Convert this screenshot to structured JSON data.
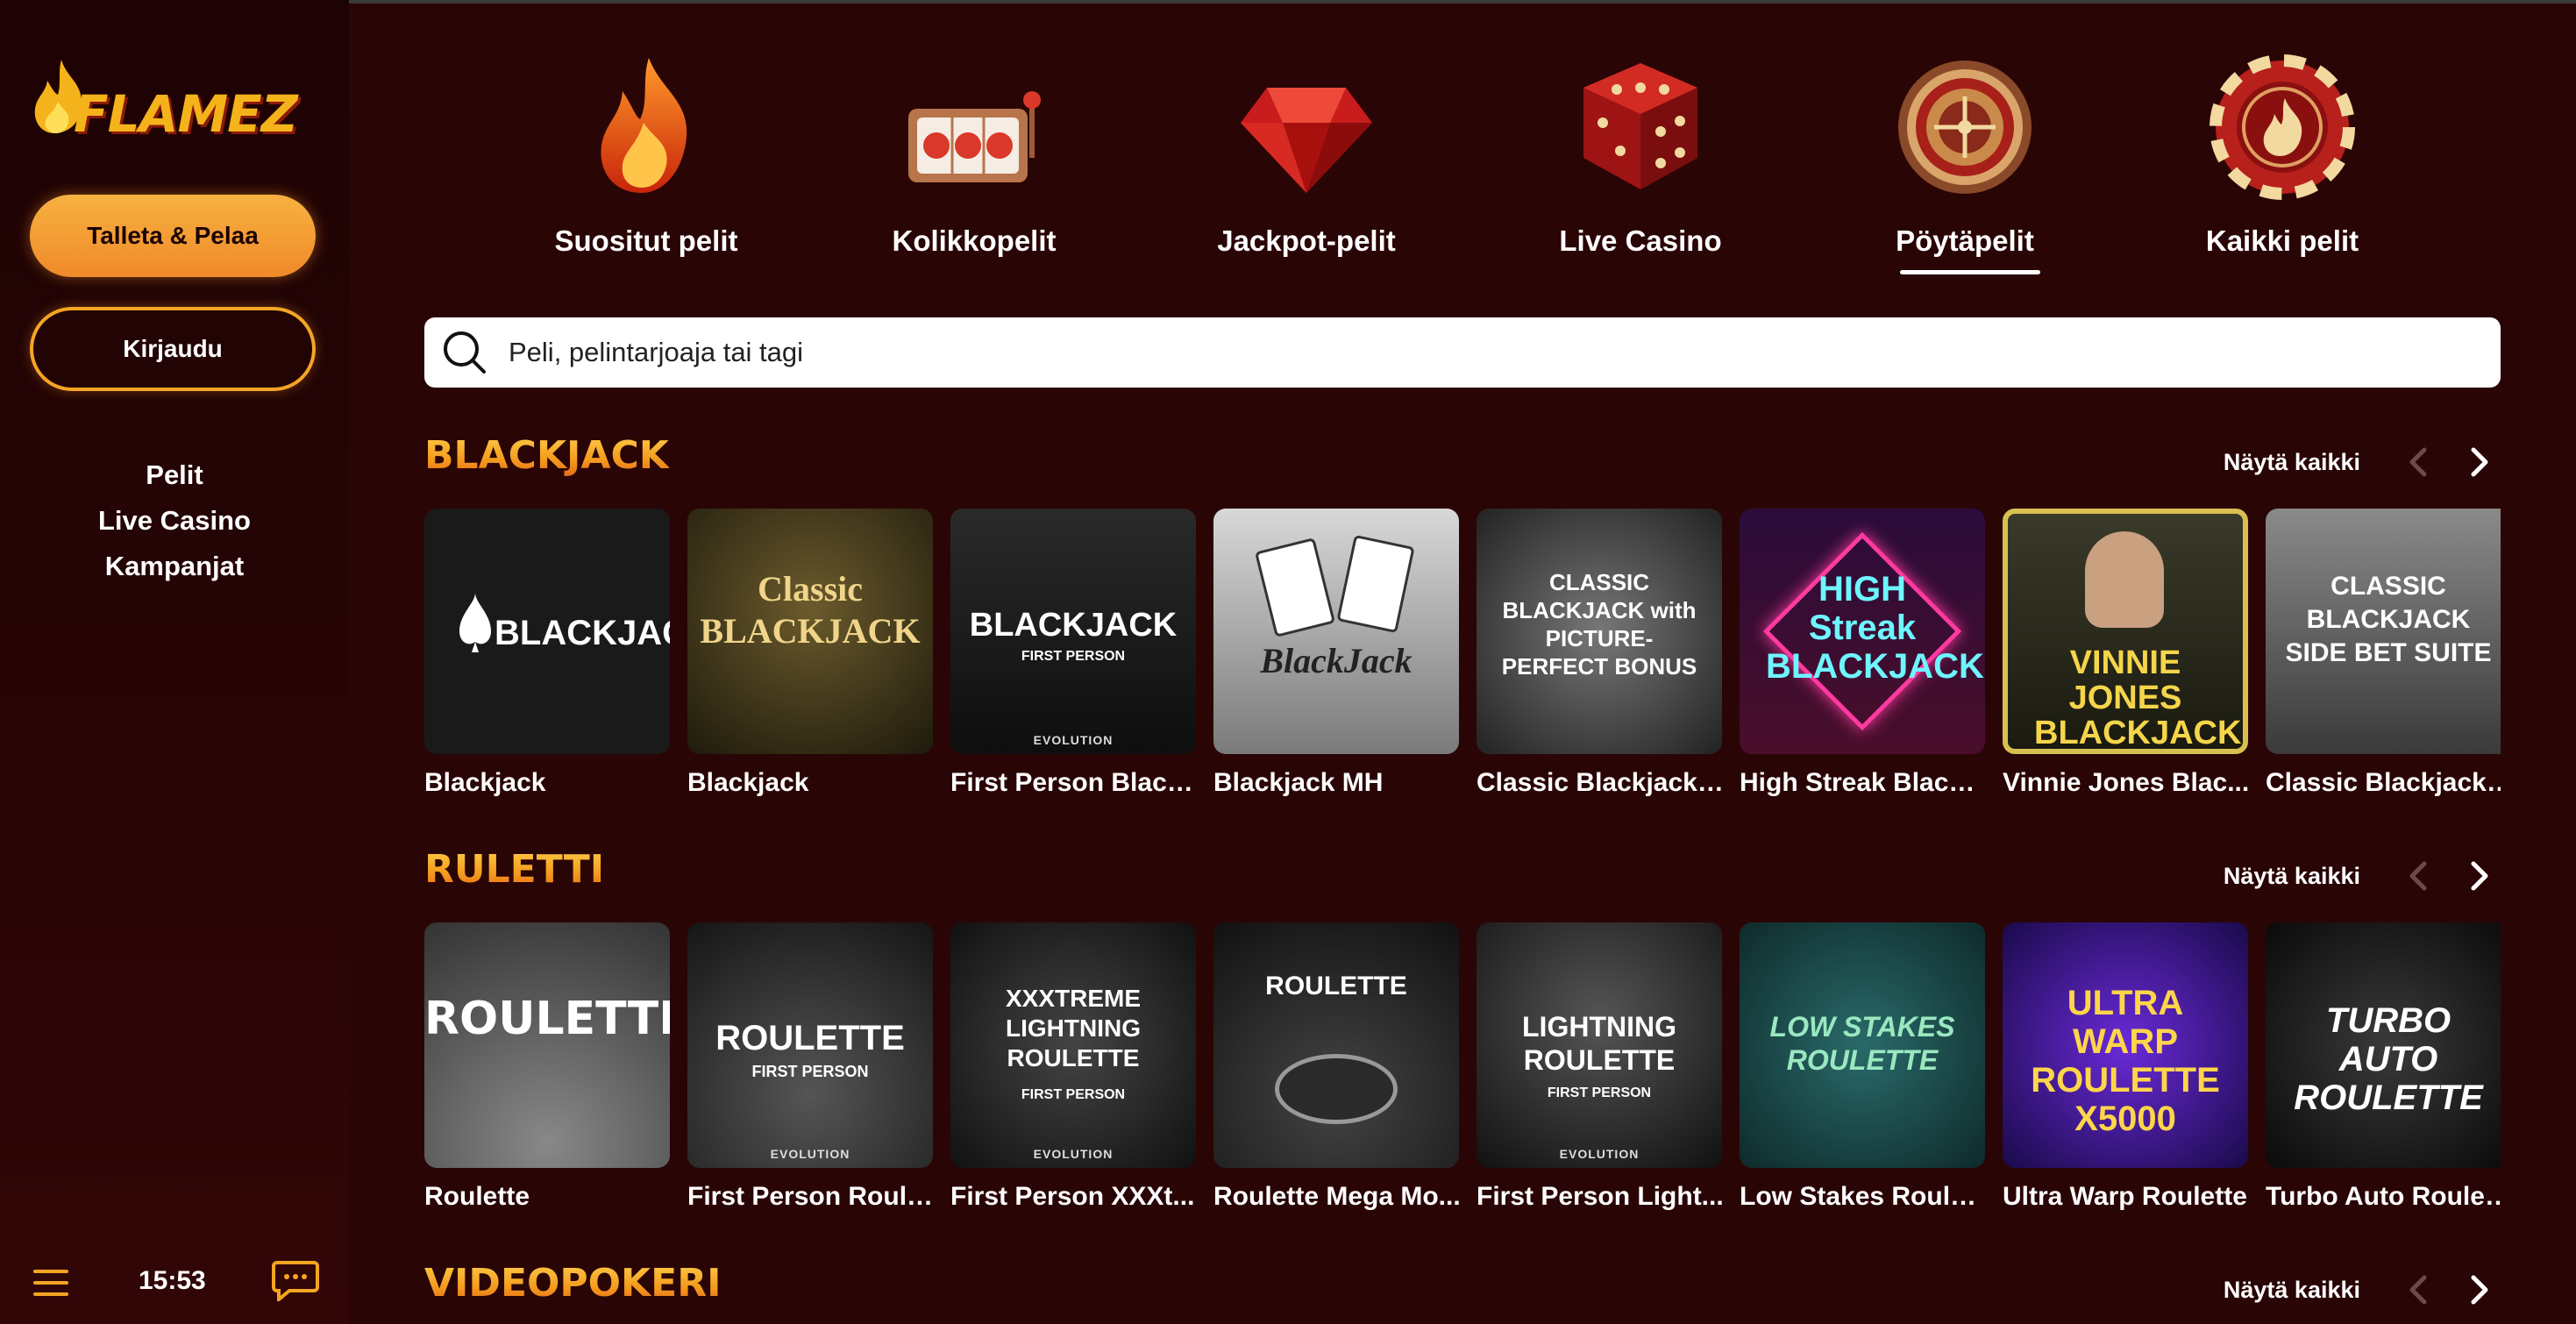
{
  "brand": {
    "logo_text": "FLAMEZ",
    "accent": "#f5a524",
    "background": "#2a0506"
  },
  "sidebar": {
    "deposit_label": "Talleta & Pelaa",
    "login_label": "Kirjaudu",
    "nav": [
      {
        "label": "Pelit"
      },
      {
        "label": "Live Casino"
      },
      {
        "label": "Kampanjat"
      }
    ],
    "clock": "15:53"
  },
  "categories": [
    {
      "label": "Suositut pelit",
      "icon": "flame-icon"
    },
    {
      "label": "Kolikkopelit",
      "icon": "slot-machine-icon"
    },
    {
      "label": "Jackpot-pelit",
      "icon": "diamond-icon"
    },
    {
      "label": "Live Casino",
      "icon": "dice-icon"
    },
    {
      "label": "Pöytäpelit",
      "icon": "roulette-wheel-icon",
      "active": true
    },
    {
      "label": "Kaikki pelit",
      "icon": "casino-chip-icon"
    }
  ],
  "search": {
    "placeholder": "Peli, pelintarjoaja tai tagi"
  },
  "sections": [
    {
      "title": "BLACKJACK",
      "view_all": "Näytä kaikki",
      "games": [
        {
          "name": "Blackjack",
          "art": "BLACKJACK"
        },
        {
          "name": "Blackjack",
          "art": "Classic BLACKJACK"
        },
        {
          "name": "First Person Black...",
          "art": "BLACKJACK"
        },
        {
          "name": "Blackjack MH",
          "art": "BlackJack"
        },
        {
          "name": "Classic Blackjack ...",
          "art": "CLASSIC BLACKJACK with PICTURE-PERFECT BONUS"
        },
        {
          "name": "High Streak Blackj...",
          "art": "HIGH Streak BLACKJACK"
        },
        {
          "name": "Vinnie Jones Blac...",
          "art": "VINNIE JONES BLACKJACK"
        },
        {
          "name": "Classic Blackjack ...",
          "art": "CLASSIC BLACKJACK SIDE BET SUITE"
        }
      ]
    },
    {
      "title": "RULETTI",
      "view_all": "Näytä kaikki",
      "games": [
        {
          "name": "Roulette",
          "art": "ROULETTE"
        },
        {
          "name": "First Person Roule...",
          "art": "ROULETTE"
        },
        {
          "name": "First Person XXXt...",
          "art": "XXXTREME LIGHTNING ROULETTE"
        },
        {
          "name": "Roulette Mega Mo...",
          "art": "ROULETTE"
        },
        {
          "name": "First Person Light...",
          "art": "LIGHTNING ROULETTE"
        },
        {
          "name": "Low Stakes Roulet...",
          "art": "LOW STAKES ROULETTE"
        },
        {
          "name": "Ultra Warp Roulette",
          "art": "ULTRA WARP ROULETTE X5000"
        },
        {
          "name": "Turbo Auto Roulette",
          "art": "TURBO AUTO ROULETTE"
        }
      ]
    },
    {
      "title": "VIDEOPOKERI",
      "view_all": "Näytä kaikki",
      "games": []
    }
  ],
  "labels": {
    "first_person": "FIRST PERSON",
    "evolution": "EVOLUTION"
  }
}
